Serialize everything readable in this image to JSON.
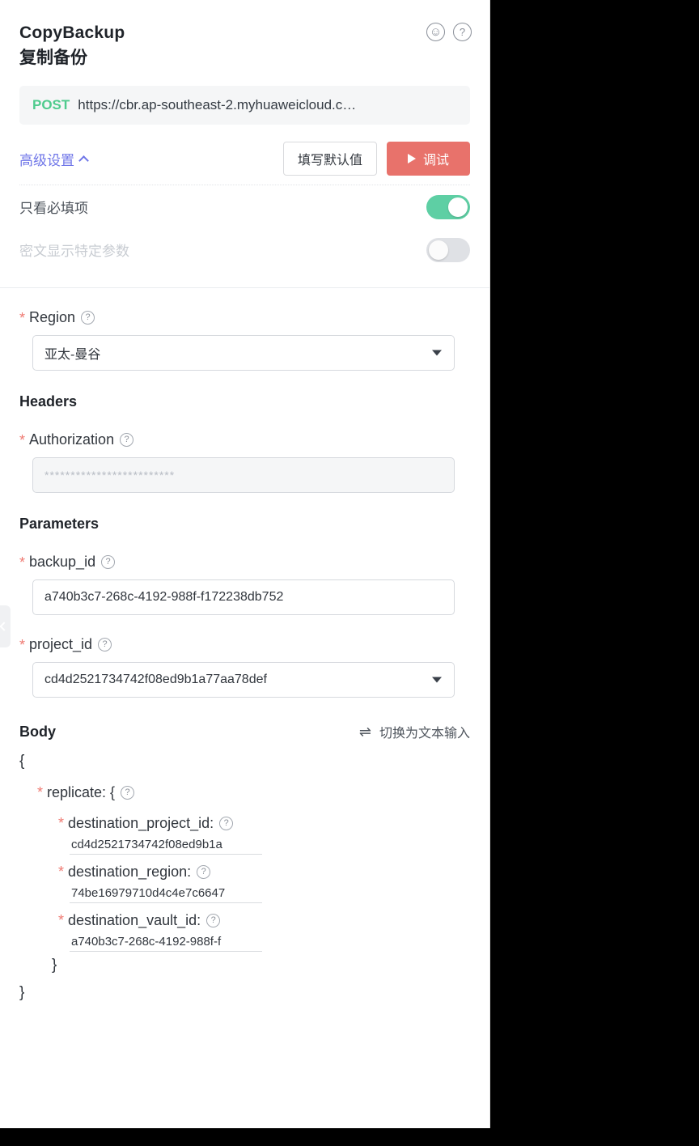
{
  "header": {
    "title_en": "CopyBackup",
    "title_cn": "复制备份",
    "smiley_icon": "☺",
    "help_icon": "?"
  },
  "url_bar": {
    "method": "POST",
    "url": "https://cbr.ap-southeast-2.myhuaweicloud.c…"
  },
  "advanced": {
    "link_label": "高级设置",
    "fill_defaults_label": "填写默认值",
    "debug_label": "调试"
  },
  "toggles": [
    {
      "label": "只看必填项",
      "state": "on"
    },
    {
      "label": "密文显示特定参数",
      "state": "off"
    }
  ],
  "region": {
    "label": "Region",
    "value": "亚太-曼谷"
  },
  "headers_section": {
    "title": "Headers",
    "authorization_label": "Authorization",
    "authorization_value": "*************************"
  },
  "parameters_section": {
    "title": "Parameters",
    "backup_id_label": "backup_id",
    "backup_id_value": "a740b3c7-268c-4192-988f-f172238db752",
    "project_id_label": "project_id",
    "project_id_value": "cd4d2521734742f08ed9b1a77aa78def"
  },
  "body_section": {
    "title": "Body",
    "switch_label": "切换为文本输入",
    "swap_icon": "⇌",
    "open_brace": "{",
    "close_brace": "}",
    "inner_close_brace": "}",
    "replicate_key": "replicate: {",
    "fields": [
      {
        "key": "destination_project_id:",
        "value": "cd4d2521734742f08ed9b1a"
      },
      {
        "key": "destination_region:",
        "value": "74be16979710d4c4e7c6647"
      },
      {
        "key": "destination_vault_id:",
        "value": "a740b3c7-268c-4192-988f-f"
      }
    ]
  },
  "colors": {
    "accent_debug": "#e8726b",
    "method_green": "#4ecb8d",
    "link_purple": "#6f76e8",
    "toggle_on": "#5ecfa4",
    "required_star": "#ef7a72"
  }
}
